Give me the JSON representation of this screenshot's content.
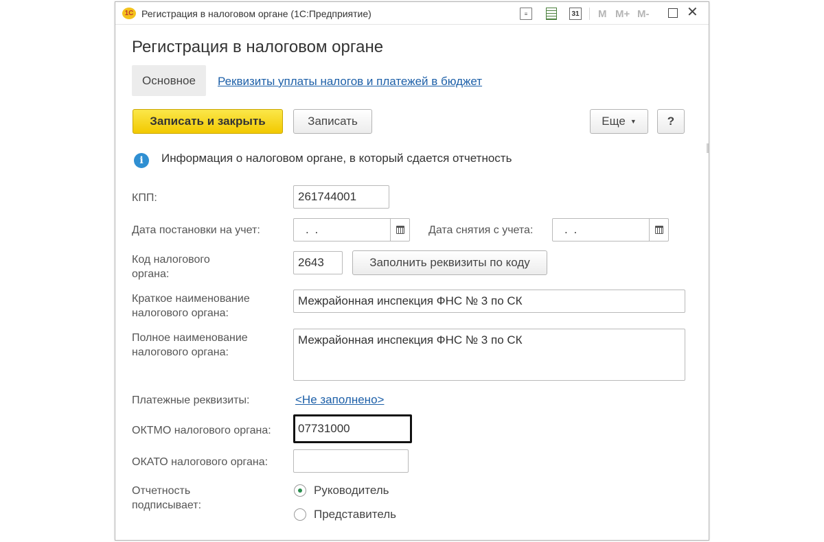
{
  "window": {
    "title": "Регистрация в налоговом органе  (1С:Предприятие)",
    "logo_text": "1С",
    "toolbar": {
      "calendar_day": "31",
      "m": "M",
      "m_plus": "M+",
      "m_minus": "M-",
      "close": "✕"
    }
  },
  "form": {
    "title": "Регистрация в налоговом органе",
    "tabs": [
      {
        "label": "Основное"
      },
      {
        "label": "Реквизиты уплаты налогов и платежей в бюджет"
      }
    ],
    "actions": {
      "save_close": "Записать и закрыть",
      "save": "Записать",
      "more": "Еще",
      "help": "?"
    },
    "info": "Информация о налоговом органе, в который сдается отчетность",
    "fields": {
      "kpp": {
        "label": "КПП:",
        "value": "261744001"
      },
      "reg_date": {
        "label": "Дата постановки на учет:",
        "value": ".  ."
      },
      "dereg_date": {
        "label": "Дата снятия с учета:",
        "value": ".  ."
      },
      "code": {
        "label_1": "Код налогового",
        "label_2": "органа:",
        "value": "2643",
        "fill_button": "Заполнить реквизиты по коду"
      },
      "short_name": {
        "label_1": "Краткое наименование",
        "label_2": "налогового органа:",
        "value": "Межрайонная инспекция ФНС № 3 по СК"
      },
      "full_name": {
        "label_1": "Полное наименование",
        "label_2": "налогового органа:",
        "value": "Межрайонная инспекция ФНС № 3 по СК"
      },
      "payment": {
        "label": "Платежные реквизиты:",
        "value": "<Не заполнено>"
      },
      "oktmo": {
        "label": "ОКТМО налогового органа:",
        "value": "07731000"
      },
      "okato": {
        "label": "ОКАТО налогового органа:",
        "value": ""
      },
      "signer": {
        "label_1": "Отчетность",
        "label_2": "подписывает:",
        "options": [
          "Руководитель",
          "Представитель"
        ],
        "selected": "Руководитель"
      }
    }
  }
}
